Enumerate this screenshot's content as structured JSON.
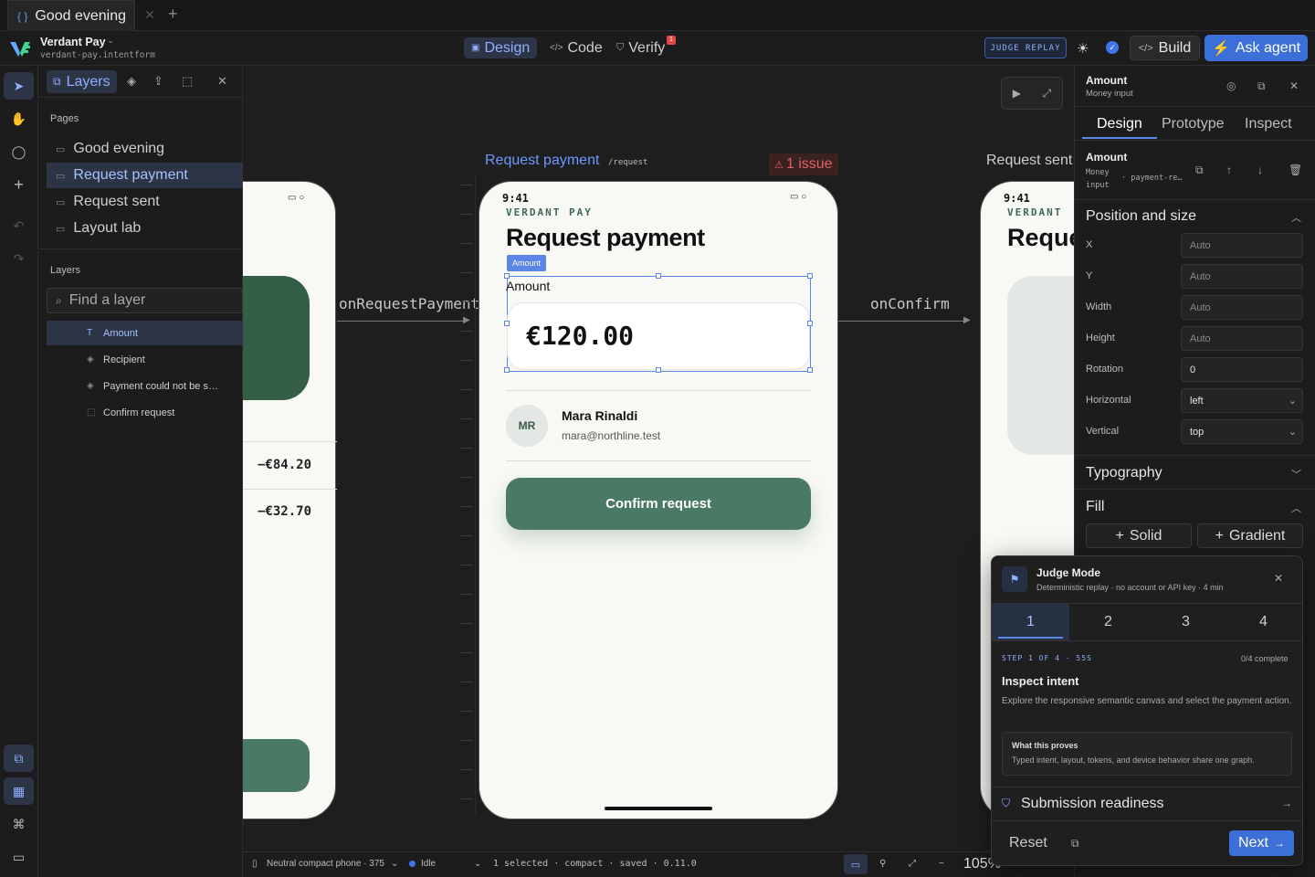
{
  "tab": {
    "title": "Good evening"
  },
  "project": {
    "name": "Verdant Pay",
    "file": "verdant-pay.intentform"
  },
  "modes": {
    "design": "Design",
    "code": "Code",
    "verify": "Verify",
    "verify_badge": "1"
  },
  "header_right": {
    "judge_replay": "JUDGE REPLAY",
    "build": "Build",
    "ask_agent": "Ask agent"
  },
  "left_panel": {
    "tab": "Layers",
    "pages_title": "Pages",
    "pages": [
      "Good evening",
      "Request payment",
      "Request sent",
      "Layout lab"
    ],
    "layers_title": "Layers",
    "search_placeholder": "Find a layer",
    "layers": [
      "Amount",
      "Recipient",
      "Payment could not be s…",
      "Confirm request"
    ]
  },
  "canvas": {
    "frame_left": {
      "amount1": "−€84.20",
      "amount2": "−€32.70"
    },
    "frame_center": {
      "label": "Request payment",
      "route": "/request",
      "issue": "1 issue",
      "time": "9:41",
      "brand": "VERDANT PAY",
      "title": "Request payment",
      "chip": "Amount",
      "amount_label": "Amount",
      "amount_value": "€120.00",
      "avatar": "MR",
      "recipient_name": "Mara Rinaldi",
      "recipient_email": "mara@northline.test",
      "confirm": "Confirm request"
    },
    "frame_right": {
      "label": "Request sent",
      "time": "9:41",
      "brand": "VERDANT",
      "title": "Reque"
    },
    "connectors": {
      "left": "onRequestPayment",
      "right": "onConfirm"
    }
  },
  "status_bar": {
    "device": "Neutral compact phone · 375",
    "state": "Idle",
    "info": "1 selected · compact · saved · 0.11.0",
    "zoom": "105%"
  },
  "right_panel": {
    "element": "Amount",
    "element_type": "Money input",
    "tabs": [
      "Design",
      "Prototype",
      "Inspect"
    ],
    "layer_name": "Amount",
    "layer_type": "Money input",
    "layer_id": "payment-re…",
    "position_title": "Position and size",
    "props": [
      {
        "label": "X",
        "value": "Auto"
      },
      {
        "label": "Y",
        "value": "Auto"
      },
      {
        "label": "Width",
        "value": "Auto"
      },
      {
        "label": "Height",
        "value": "Auto"
      },
      {
        "label": "Rotation",
        "value": "0"
      }
    ],
    "horizontal": {
      "label": "Horizontal",
      "value": "left"
    },
    "vertical": {
      "label": "Vertical",
      "value": "top"
    },
    "typography_title": "Typography",
    "fill_title": "Fill",
    "fill_solid": "Solid",
    "fill_gradient": "Gradient"
  },
  "judge": {
    "title": "Judge Mode",
    "subtitle": "Deterministic replay · no account or API key · 4 min",
    "steps": [
      "1",
      "2",
      "3",
      "4"
    ],
    "step_meta": "STEP 1 OF 4 · 55S",
    "progress": "0/4 complete",
    "heading": "Inspect intent",
    "body": "Explore the responsive semantic canvas and select the payment action.",
    "proves_title": "What this proves",
    "proves_body": "Typed intent, layout, tokens, and device behavior share one graph.",
    "readiness": "Submission readiness",
    "reset": "Reset",
    "next": "Next"
  }
}
